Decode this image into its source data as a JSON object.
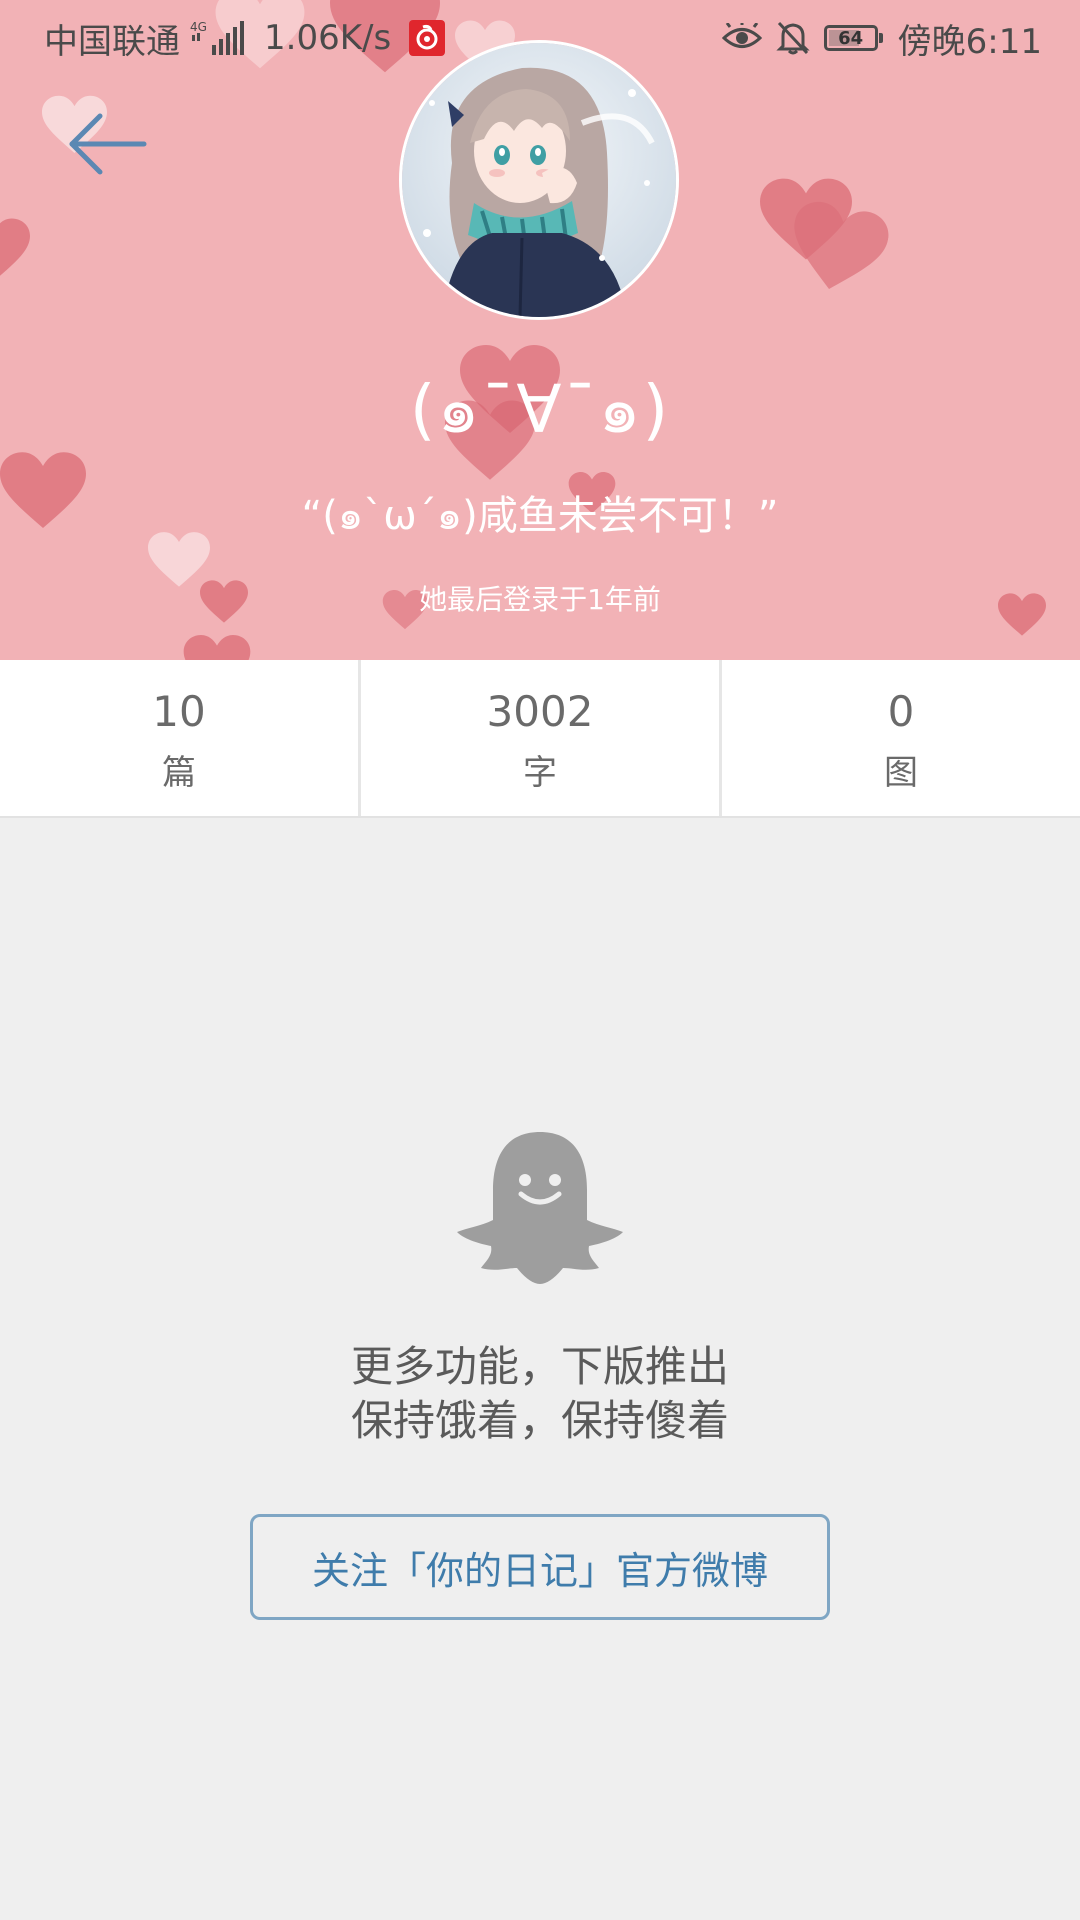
{
  "status_bar": {
    "carrier": "中国联通",
    "network_type": "4G",
    "speed": "1.06K/s",
    "battery_level": "64",
    "time": "傍晚6:11"
  },
  "header": {
    "profile_name": "(๑¯∀¯๑)",
    "bio": "“(๑`ω´๑)咸鱼未尝不可！”",
    "last_login": "她最后登录于1年前"
  },
  "stats": [
    {
      "value": "10",
      "label": "篇"
    },
    {
      "value": "3002",
      "label": "字"
    },
    {
      "value": "0",
      "label": "图"
    }
  ],
  "empty_state": {
    "line1": "更多功能，下版推出",
    "line2": "保持饿着，保持傻着"
  },
  "follow_button": {
    "label": "关注「你的日记」官方微博"
  },
  "colors": {
    "header_bg": "#f2b2b6",
    "heart": "#dc6f79",
    "accent": "#3f7cab",
    "ghost": "#9e9e9e",
    "page_bg": "#efefef"
  }
}
